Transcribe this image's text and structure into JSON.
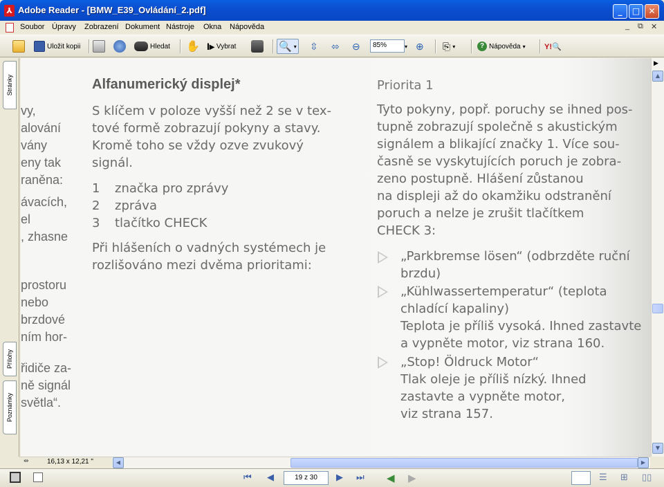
{
  "window": {
    "title": "Adobe Reader - [BMW_E39_Ovládání_2.pdf]",
    "min_glyph": "_",
    "max_glyph": "□",
    "close_glyph": "✕"
  },
  "menu": {
    "items": [
      "Soubor",
      "Úpravy",
      "Zobrazení",
      "Dokument",
      "Nástroje",
      "Okna",
      "Nápověda"
    ],
    "doc_controls": [
      "_",
      "⧉",
      "✕"
    ]
  },
  "toolbar": {
    "save_copy": "Uložit kopii",
    "find": "Hledat",
    "select": "Vybrat",
    "zoom_value": "85%",
    "help": "Nápověda"
  },
  "side_tabs": {
    "pages": "Stránky",
    "attachments": "Přílohy",
    "comments": "Poznámky"
  },
  "document": {
    "left_fragments": [
      "vy,",
      "alování",
      "vány",
      "eny tak",
      "raněna:",
      "ávacích,",
      "el",
      ", zhasne",
      "prostoru",
      "nebo",
      "brzdové",
      "ním hor-",
      "řidiče za-",
      "ně signál",
      "světla“."
    ],
    "heading": "Alfanumerický displej*",
    "intro": [
      "S klíčem v poloze vyšší než 2 se v tex-",
      "tové formě zobrazují pokyny a stavy.",
      "Kromě toho se vždy ozve zvukový",
      "signál."
    ],
    "list": [
      {
        "num": "1",
        "text": "značka pro zprávy"
      },
      {
        "num": "2",
        "text": "zpráva"
      },
      {
        "num": "3",
        "text": "tlačítko CHECK"
      }
    ],
    "priority_note": [
      "Při hlášeních o vadných systémech je",
      "rozlišováno mezi dvěma prioritami:"
    ],
    "priority_title": "Priorita 1",
    "priority_text": [
      "Tyto pokyny, popř. poruchy se ihned pos-",
      "tupně zobrazují společně s akustickým",
      "signálem a blikající značky 1. Více sou-",
      "časně se vyskytujících poruch je zobra-",
      "zeno postupně. Hlášení zůstanou",
      "na displeji až do okamžiku odstranění",
      "poruch a nelze je zrušit tlačítkem",
      "CHECK 3:"
    ],
    "bullets": [
      {
        "lines": [
          "„Parkbremse lösen“ (odbrzděte ruční",
          "brzdu)"
        ]
      },
      {
        "lines": [
          "„Kühlwassertemperatur“ (teplota",
          "chladící kapaliny)",
          "Teplota je příliš vysoká. Ihned zastavte",
          "a vypněte motor, viz strana 160."
        ]
      },
      {
        "lines": [
          "„Stop! Öldruck Motor“",
          "Tlak oleje je příliš nízký. Ihned",
          "zastavte a vypněte motor,",
          "viz strana 157."
        ]
      }
    ]
  },
  "status": {
    "page_size": "16,13 x 12,21 \"",
    "page_indicator": "19 z 30"
  }
}
